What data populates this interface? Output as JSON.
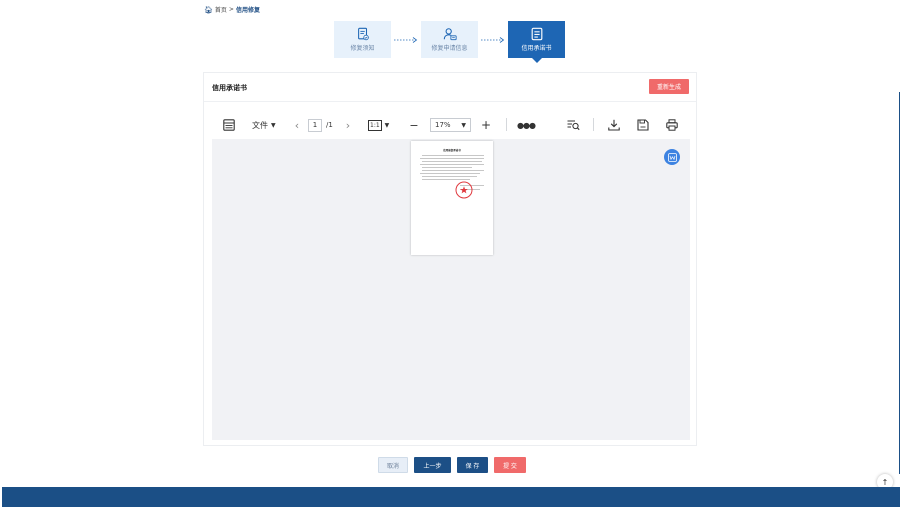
{
  "breadcrumb": {
    "home": "首页",
    "separator": ">",
    "current": "信用修复"
  },
  "steps": [
    {
      "label": "修复须知",
      "icon": "document-check-icon",
      "active": false
    },
    {
      "label": "修复申请信息",
      "icon": "user-card-icon",
      "active": false
    },
    {
      "label": "信用承诺书",
      "icon": "document-list-icon",
      "active": true
    }
  ],
  "panel": {
    "title": "信用承诺书",
    "regenerate_label": "重新生成"
  },
  "toolbar": {
    "file_label": "文件",
    "page_current": "1",
    "page_total": "/1",
    "fit_label": "1:1",
    "zoom_value": "17%"
  },
  "document": {
    "title": "信用修复承诺书"
  },
  "actions": {
    "cancel_label": "取消",
    "prev_label": "上一步",
    "save_label": "保 存",
    "submit_label": "提 交"
  },
  "colors": {
    "primary": "#1e66b4",
    "dark_blue": "#1b4f86",
    "danger": "#f06a6a",
    "step_bg": "#e7f1fb"
  }
}
